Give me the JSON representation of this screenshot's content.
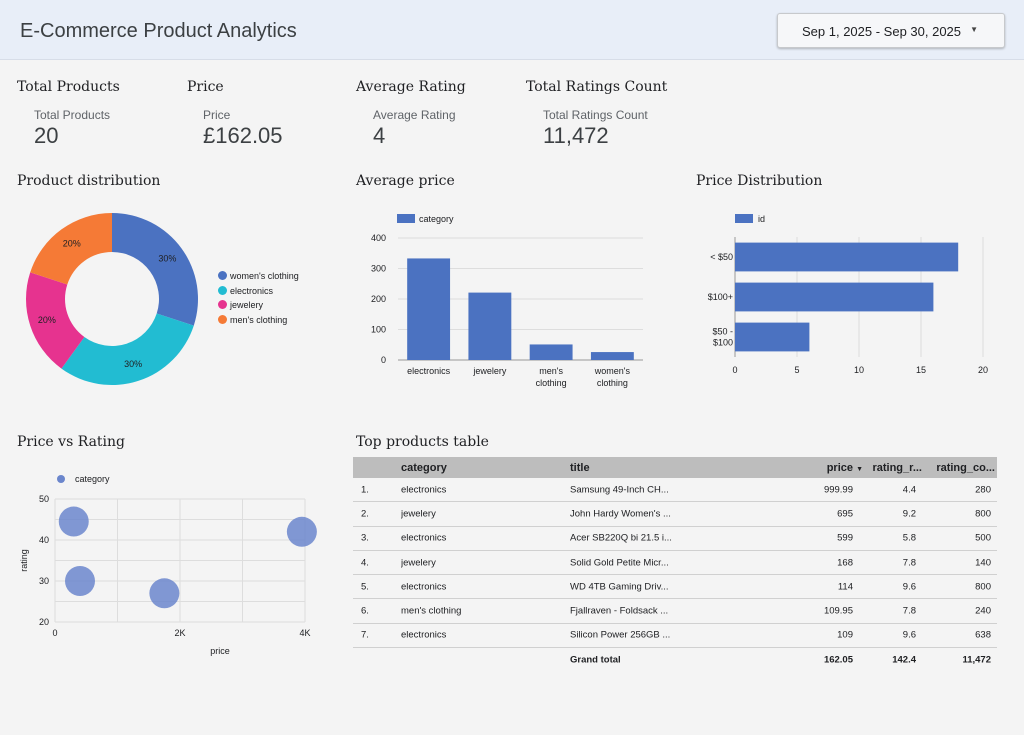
{
  "header": {
    "title": "E-Commerce Product Analytics",
    "date_range": "Sep 1, 2025 - Sep 30, 2025"
  },
  "kpis": [
    {
      "title": "Total Products",
      "label": "Total Products",
      "value": "20"
    },
    {
      "title": "Price",
      "label": "Price",
      "value": "£162.05"
    },
    {
      "title": "Average Rating",
      "label": "Average Rating",
      "value": "4"
    },
    {
      "title": "Total Ratings Count",
      "label": "Total Ratings Count",
      "value": "11,472"
    }
  ],
  "sections": {
    "product_distribution": "Product distribution",
    "average_price": "Average price",
    "price_distribution": "Price Distribution",
    "price_vs_rating": "Price vs Rating",
    "top_products": "Top products table"
  },
  "colors": {
    "blue": "#4b72c1",
    "teal": "#22bcd2",
    "pink": "#e6338f",
    "orange": "#f57a36",
    "scatter": "#6b86cc"
  },
  "chart_data": [
    {
      "type": "pie",
      "title": "Product distribution",
      "categories": [
        "women's clothing",
        "electronics",
        "jewelery",
        "men's clothing"
      ],
      "values": [
        30,
        30,
        20,
        20
      ],
      "labels": [
        "30%",
        "30%",
        "20%",
        "20%"
      ],
      "colors": [
        "#4b72c1",
        "#22bcd2",
        "#e6338f",
        "#f57a36"
      ],
      "legend": "right"
    },
    {
      "type": "bar",
      "title": "Average price",
      "legend": "category",
      "categories": [
        "electronics",
        "jewelery",
        "men's clothing",
        "women's clothing"
      ],
      "category_lines": [
        [
          "electronics"
        ],
        [
          "jewelery"
        ],
        [
          "men's",
          "clothing"
        ],
        [
          "women's",
          "clothing"
        ]
      ],
      "values": [
        333,
        221,
        51,
        26
      ],
      "ylim": [
        0,
        400
      ],
      "yticks": [
        "0",
        "100",
        "200",
        "300",
        "400"
      ],
      "ytick_values": [
        0,
        100,
        200,
        300,
        400
      ]
    },
    {
      "type": "bar",
      "orientation": "horizontal",
      "title": "Price Distribution",
      "legend": "id",
      "categories": [
        "< $50",
        "$100+",
        "$50 - $100"
      ],
      "category_lines": [
        [
          "< $50"
        ],
        [
          "$100+"
        ],
        [
          "$50 -",
          "$100"
        ]
      ],
      "values": [
        18,
        16,
        6
      ],
      "xlim": [
        0,
        20
      ],
      "xticks": [
        "0",
        "5",
        "10",
        "15",
        "20"
      ],
      "xtick_values": [
        0,
        5,
        10,
        15,
        20
      ]
    },
    {
      "type": "scatter",
      "title": "Price vs Rating",
      "legend": "category",
      "xlabel": "price",
      "ylabel": "rating",
      "xlim": [
        0,
        4000
      ],
      "ylim": [
        20,
        50
      ],
      "xticks": [
        "0",
        "2K",
        "4K"
      ],
      "xtick_values": [
        0,
        2000,
        4000
      ],
      "yticks": [
        "20",
        "30",
        "40",
        "50"
      ],
      "ytick_values": [
        20,
        30,
        40,
        50
      ],
      "points": [
        {
          "x": 300,
          "y": 44.5
        },
        {
          "x": 400,
          "y": 30
        },
        {
          "x": 1750,
          "y": 27
        },
        {
          "x": 3950,
          "y": 42
        }
      ]
    }
  ],
  "table": {
    "headers": [
      "category",
      "title",
      "price",
      "rating_r...",
      "rating_co..."
    ],
    "sort_indicator": "▼",
    "rows": [
      {
        "num": "1.",
        "category": "electronics",
        "title": "Samsung 49-Inch CH...",
        "price": "999.99",
        "rating_rate": "4.4",
        "rating_count": "280"
      },
      {
        "num": "2.",
        "category": "jewelery",
        "title": "John Hardy Women's ...",
        "price": "695",
        "rating_rate": "9.2",
        "rating_count": "800"
      },
      {
        "num": "3.",
        "category": "electronics",
        "title": "Acer SB220Q bi 21.5 i...",
        "price": "599",
        "rating_rate": "5.8",
        "rating_count": "500"
      },
      {
        "num": "4.",
        "category": "jewelery",
        "title": "Solid Gold Petite Micr...",
        "price": "168",
        "rating_rate": "7.8",
        "rating_count": "140"
      },
      {
        "num": "5.",
        "category": "electronics",
        "title": "WD 4TB Gaming Driv...",
        "price": "114",
        "rating_rate": "9.6",
        "rating_count": "800"
      },
      {
        "num": "6.",
        "category": "men's clothing",
        "title": "Fjallraven - Foldsack ...",
        "price": "109.95",
        "rating_rate": "7.8",
        "rating_count": "240"
      },
      {
        "num": "7.",
        "category": "electronics",
        "title": "Silicon Power 256GB ...",
        "price": "109",
        "rating_rate": "9.6",
        "rating_count": "638"
      }
    ],
    "grand_total": {
      "label": "Grand total",
      "price": "162.05",
      "rating_rate": "142.4",
      "rating_count": "11,472"
    }
  }
}
